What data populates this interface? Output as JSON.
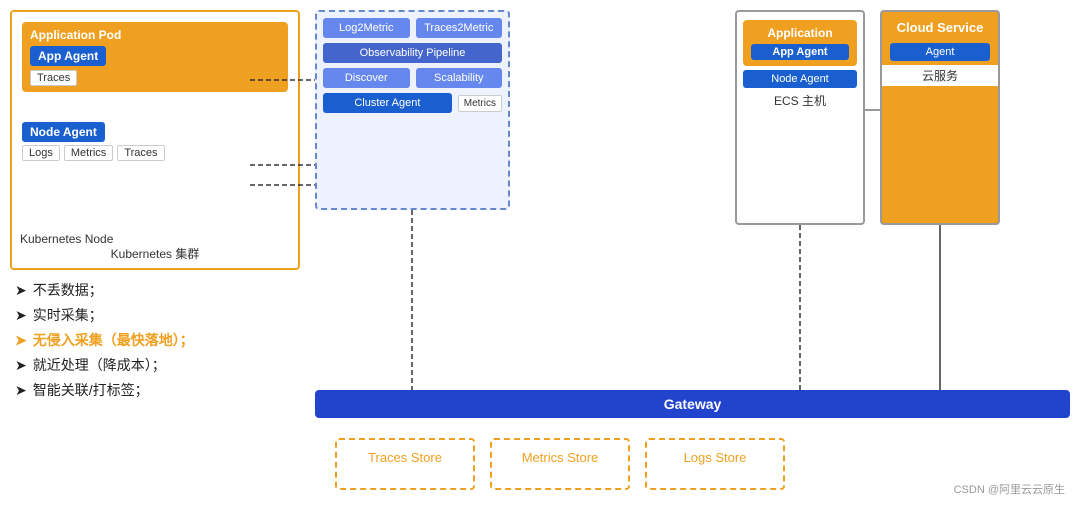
{
  "diagram": {
    "kubernetes": {
      "outer_label": "Kubernetes Node",
      "cluster_label": "Kubernetes 集群",
      "application_pod": {
        "label": "Application Pod",
        "app_agent": "App Agent",
        "traces_tag": "Traces"
      },
      "node_agent": {
        "label": "Node Agent",
        "tags": [
          "Logs",
          "Metrics",
          "Traces"
        ]
      }
    },
    "pipeline": {
      "boxes": [
        {
          "label": "Log2Metric"
        },
        {
          "label": "Traces2Metric"
        },
        {
          "label": "Observability Pipeline"
        },
        {
          "label": "Discover"
        },
        {
          "label": "Scalability"
        },
        {
          "label": "Cluster Agent"
        },
        {
          "label": "Metrics"
        }
      ]
    },
    "ecs": {
      "label": "ECS 主机",
      "application": {
        "label": "Application",
        "app_agent": "App Agent"
      },
      "node_agent": "Node Agent"
    },
    "cloud": {
      "label": "云服务",
      "title": "Cloud Service",
      "agent": "Agent"
    },
    "gateway": {
      "label": "Gateway"
    },
    "stores": [
      {
        "label": "Traces Store"
      },
      {
        "label": "Metrics Store"
      },
      {
        "label": "Logs Store"
      }
    ]
  },
  "features": [
    {
      "text": "不丢数据；",
      "highlight": false
    },
    {
      "text": "实时采集；",
      "highlight": false
    },
    {
      "text": "无侵入采集（最快落地）；",
      "highlight": true
    },
    {
      "text": "就近处理（降成本）；",
      "highlight": false
    },
    {
      "text": "智能关联/打标签；",
      "highlight": false
    }
  ],
  "watermark": "CSDN @阿里云云原生"
}
